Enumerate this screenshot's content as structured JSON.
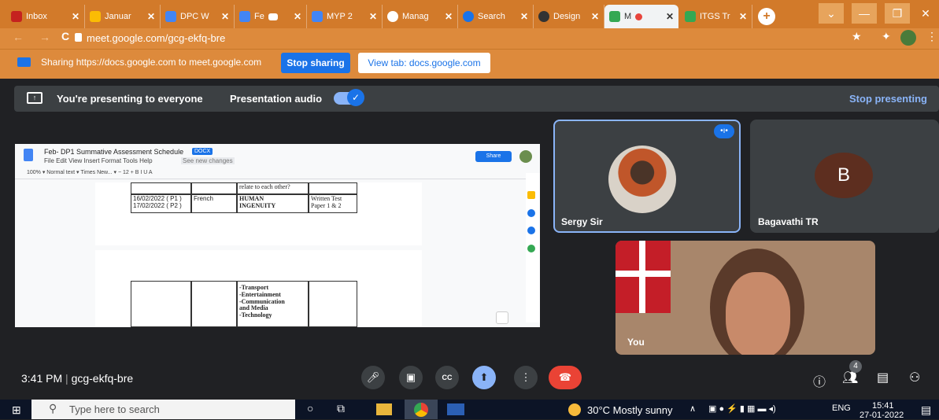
{
  "tabs": [
    {
      "label": "Inbox",
      "favicon_color": "#c5221f"
    },
    {
      "label": "Januar",
      "favicon_color": "#fbbc04"
    },
    {
      "label": "DPC W",
      "favicon_color": "#4285f4"
    },
    {
      "label": "Fe",
      "favicon_color": "#4285f4"
    },
    {
      "label": "MYP 2",
      "favicon_color": "#4285f4"
    },
    {
      "label": "Manag",
      "favicon_color": "#ffffff"
    },
    {
      "label": "Search",
      "favicon_color": "#1a73e8"
    },
    {
      "label": "Design",
      "favicon_color": "#333333"
    },
    {
      "label": "M",
      "favicon_color": "#34a853"
    },
    {
      "label": "ITGS Tr",
      "favicon_color": "#34a853"
    }
  ],
  "address": {
    "url": "meet.google.com/gcg-ekfq-bre"
  },
  "share_bar": {
    "message": "Sharing https://docs.google.com to meet.google.com",
    "stop_label": "Stop sharing",
    "view_label": "View tab: docs.google.com"
  },
  "present_bar": {
    "message": "You're presenting to everyone",
    "audio_label": "Presentation audio",
    "stop_label": "Stop presenting"
  },
  "doc": {
    "title": "Feb- DP1 Summative Assessment Schedule",
    "badge": "DOCX",
    "menu": "File  Edit  View  Insert  Format  Tools  Help",
    "changes": "See new changes",
    "share_label": "Share",
    "toolbar": "100%  ▾   Normal text  ▾   Times New...  ▾   −  12  +   B  I  U  A",
    "row_text": "relate to each other?",
    "date": "16/02/2022 ( P1 )\n17/02/2022 ( P2 )",
    "subject": "French",
    "theme": "HUMAN\nINGENUITY",
    "mode": "Written Test\nPaper 1 & 2",
    "topics": "-Transport\n-Entertainment\n-Communication\nand Media\n-Technology"
  },
  "participants": [
    {
      "name": "Sergy Sir"
    },
    {
      "name": "Bagavathi TR",
      "initial": "B"
    },
    {
      "name": "You"
    }
  ],
  "meeting": {
    "time": "3:41 PM",
    "code": "gcg-ekfq-bre",
    "people_count": "4"
  },
  "taskbar": {
    "search_placeholder": "Type here to search",
    "weather": "30°C  Mostly sunny",
    "lang": "ENG",
    "clock_time": "15:41",
    "clock_date": "27-01-2022"
  }
}
